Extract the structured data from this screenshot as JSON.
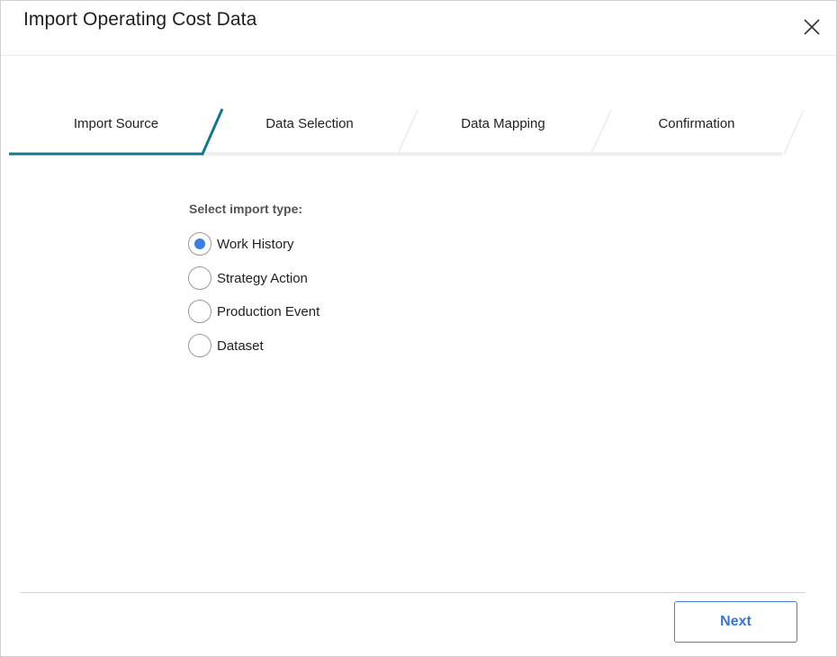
{
  "dialog": {
    "title": "Import Operating Cost Data",
    "close_icon": "close-icon"
  },
  "stepper": {
    "steps": [
      {
        "label": "Import Source",
        "active": true
      },
      {
        "label": "Data Selection",
        "active": false
      },
      {
        "label": "Data Mapping",
        "active": false
      },
      {
        "label": "Confirmation",
        "active": false
      }
    ],
    "active_color": "#17768a",
    "inactive_color": "#efefef"
  },
  "form": {
    "label": "Select import type:",
    "options": [
      {
        "label": "Work History",
        "selected": true
      },
      {
        "label": "Strategy Action",
        "selected": false
      },
      {
        "label": "Production Event",
        "selected": false
      },
      {
        "label": "Dataset",
        "selected": false
      }
    ],
    "radio_color": "#3b7fe0"
  },
  "footer": {
    "next_label": "Next"
  }
}
